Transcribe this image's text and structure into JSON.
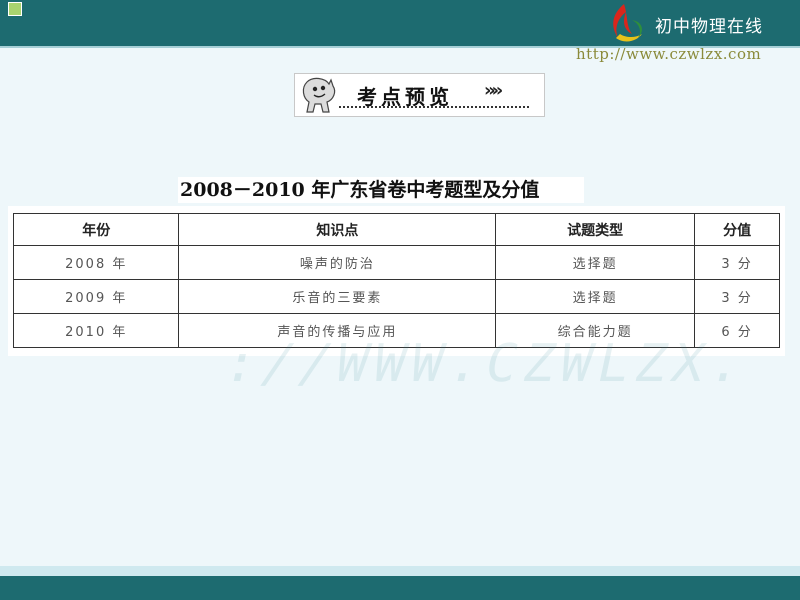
{
  "header": {
    "site_name": "初中物理在线",
    "site_url": "http://www.czwlzx.com",
    "logo_icon": "flame-logo-icon",
    "bar_color": "#1d6b70"
  },
  "banner": {
    "title": "考点预览",
    "chevrons": "»»",
    "mascot_icon": "mascot-icon"
  },
  "table": {
    "caption": "2008－2010 年广东省卷中考题型及分值",
    "columns": [
      "年份",
      "知识点",
      "试题类型",
      "分值"
    ],
    "rows": [
      [
        "2008 年",
        "噪声的防治",
        "选择题",
        "3 分"
      ],
      [
        "2009 年",
        "乐音的三要素",
        "选择题",
        "3 分"
      ],
      [
        "2010 年",
        "声音的传播与应用",
        "综合能力题",
        "6 分"
      ]
    ]
  },
  "watermark": {
    "text": "://WWW.CZWLZX."
  }
}
